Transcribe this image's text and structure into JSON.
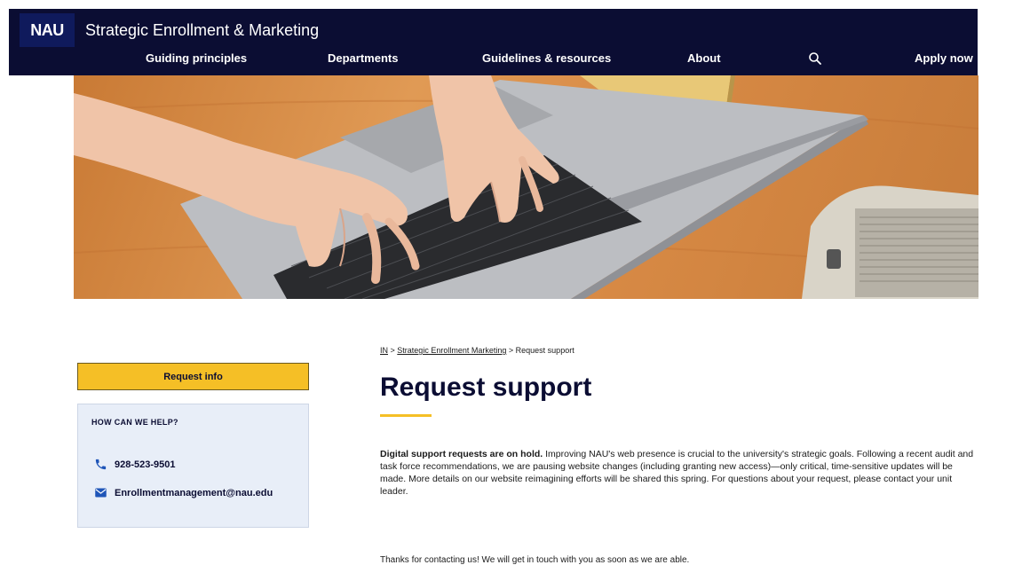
{
  "header": {
    "logo_text": "NAU",
    "site_title": "Strategic Enrollment & Marketing",
    "nav": [
      "Guiding principles",
      "Departments",
      "Guidelines & resources",
      "About"
    ],
    "search_icon": "search-icon",
    "apply_label": "Apply now",
    "bg_color": "#0b0d33"
  },
  "hero": {
    "image": "hands-typing-on-laptop"
  },
  "sidebar": {
    "request_info_label": "Request info",
    "help_title": "HOW CAN WE HELP?",
    "phone": "928-523-9501",
    "email": "Enrollmentmanagement@nau.edu",
    "accent_color": "#f5bf26"
  },
  "breadcrumb": {
    "items": [
      "IN",
      "Strategic Enrollment Marketing",
      "Request support"
    ],
    "separator": ">"
  },
  "main": {
    "title": "Request support",
    "notice_bold": "Digital support requests are on hold.",
    "notice_text": " Improving NAU's web presence is crucial to the university's strategic goals. Following a recent audit and task force recommendations, we are pausing website changes (including granting new access)—only critical, time-sensitive updates will be made. More details on our website reimagining efforts will be shared this spring.  For questions about your request, please contact your unit leader.",
    "thanks": "Thanks for contacting us! We will get in touch with you as soon as we are able."
  }
}
